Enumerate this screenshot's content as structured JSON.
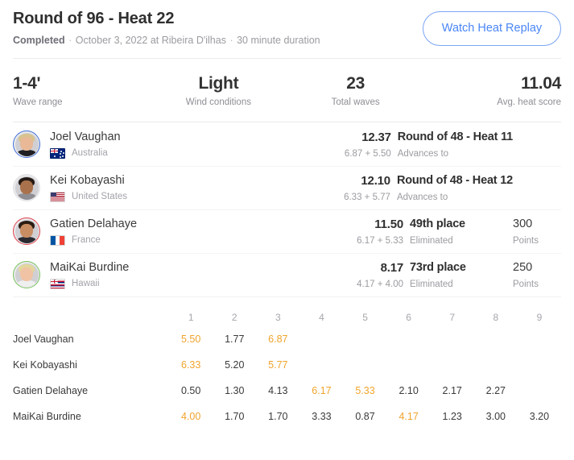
{
  "header": {
    "title": "Round of 96 - Heat 22",
    "status": "Completed",
    "separator": "·",
    "date_location": "October 3, 2022 at Ribeira D'ilhas",
    "duration": "30 minute duration",
    "replay_button": "Watch Heat Replay",
    "accent_color": "#4a86f7"
  },
  "stats": [
    {
      "value": "1-4'",
      "label": "Wave range"
    },
    {
      "value": "Light",
      "label": "Wind conditions"
    },
    {
      "value": "23",
      "label": "Total waves"
    },
    {
      "value": "11.04",
      "label": "Avg. heat score"
    }
  ],
  "surfers": [
    {
      "name": "Joel Vaughan",
      "country": "Australia",
      "flag": "au-flag-icon",
      "ring": "blue",
      "total": "12.37",
      "parts": "6.87 + 5.50",
      "result": "Round of 48 - Heat 11",
      "result_sub": "Advances to",
      "points": "",
      "points_label": ""
    },
    {
      "name": "Kei Kobayashi",
      "country": "United States",
      "flag": "us-flag-icon",
      "ring": "gray",
      "total": "12.10",
      "parts": "6.33 + 5.77",
      "result": "Round of 48 - Heat 12",
      "result_sub": "Advances to",
      "points": "",
      "points_label": ""
    },
    {
      "name": "Gatien Delahaye",
      "country": "France",
      "flag": "fr-flag-icon",
      "ring": "red",
      "total": "11.50",
      "parts": "6.17 + 5.33",
      "result": "49th place",
      "result_sub": "Eliminated",
      "points": "300",
      "points_label": "Points"
    },
    {
      "name": "MaiKai Burdine",
      "country": "Hawaii",
      "flag": "hi-flag-icon",
      "ring": "green",
      "total": "8.17",
      "parts": "4.17 + 4.00",
      "result": "73rd place",
      "result_sub": "Eliminated",
      "points": "250",
      "points_label": "Points"
    }
  ],
  "wave_table": {
    "counted_color": "#f0a42c",
    "columns": [
      "1",
      "2",
      "3",
      "4",
      "5",
      "6",
      "7",
      "8",
      "9"
    ],
    "rows": [
      {
        "name": "Joel Vaughan",
        "scores": [
          {
            "v": "5.50",
            "counted": true
          },
          {
            "v": "1.77",
            "counted": false
          },
          {
            "v": "6.87",
            "counted": true
          },
          {
            "v": "",
            "counted": false
          },
          {
            "v": "",
            "counted": false
          },
          {
            "v": "",
            "counted": false
          },
          {
            "v": "",
            "counted": false
          },
          {
            "v": "",
            "counted": false
          },
          {
            "v": "",
            "counted": false
          }
        ]
      },
      {
        "name": "Kei Kobayashi",
        "scores": [
          {
            "v": "6.33",
            "counted": true
          },
          {
            "v": "5.20",
            "counted": false
          },
          {
            "v": "5.77",
            "counted": true
          },
          {
            "v": "",
            "counted": false
          },
          {
            "v": "",
            "counted": false
          },
          {
            "v": "",
            "counted": false
          },
          {
            "v": "",
            "counted": false
          },
          {
            "v": "",
            "counted": false
          },
          {
            "v": "",
            "counted": false
          }
        ]
      },
      {
        "name": "Gatien Delahaye",
        "scores": [
          {
            "v": "0.50",
            "counted": false
          },
          {
            "v": "1.30",
            "counted": false
          },
          {
            "v": "4.13",
            "counted": false
          },
          {
            "v": "6.17",
            "counted": true
          },
          {
            "v": "5.33",
            "counted": true
          },
          {
            "v": "2.10",
            "counted": false
          },
          {
            "v": "2.17",
            "counted": false
          },
          {
            "v": "2.27",
            "counted": false
          },
          {
            "v": "",
            "counted": false
          }
        ]
      },
      {
        "name": "MaiKai Burdine",
        "scores": [
          {
            "v": "4.00",
            "counted": true
          },
          {
            "v": "1.70",
            "counted": false
          },
          {
            "v": "1.70",
            "counted": false
          },
          {
            "v": "3.33",
            "counted": false
          },
          {
            "v": "0.87",
            "counted": false
          },
          {
            "v": "4.17",
            "counted": true
          },
          {
            "v": "1.23",
            "counted": false
          },
          {
            "v": "3.00",
            "counted": false
          },
          {
            "v": "3.20",
            "counted": false
          }
        ]
      }
    ]
  }
}
